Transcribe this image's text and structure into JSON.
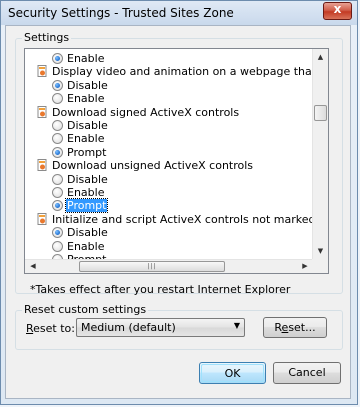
{
  "window": {
    "title": "Security Settings - Trusted Sites Zone",
    "close_glyph": "x"
  },
  "settings_group": {
    "label": "Settings"
  },
  "list": {
    "rows": [
      {
        "kind": "option",
        "label": "Enable",
        "checked": true
      },
      {
        "kind": "heading",
        "label": "Display video and animation on a webpage that does not use"
      },
      {
        "kind": "option",
        "label": "Disable",
        "checked": true
      },
      {
        "kind": "option",
        "label": "Enable",
        "checked": false
      },
      {
        "kind": "heading",
        "label": "Download signed ActiveX controls"
      },
      {
        "kind": "option",
        "label": "Disable",
        "checked": false
      },
      {
        "kind": "option",
        "label": "Enable",
        "checked": false
      },
      {
        "kind": "option",
        "label": "Prompt",
        "checked": true
      },
      {
        "kind": "heading",
        "label": "Download unsigned ActiveX controls"
      },
      {
        "kind": "option",
        "label": "Disable",
        "checked": false
      },
      {
        "kind": "option",
        "label": "Enable",
        "checked": false
      },
      {
        "kind": "option",
        "label": "Prompt",
        "checked": true,
        "focused": true
      },
      {
        "kind": "heading",
        "label": "Initialize and script ActiveX controls not marked as safe for sc"
      },
      {
        "kind": "option",
        "label": "Disable",
        "checked": true
      },
      {
        "kind": "option",
        "label": "Enable",
        "checked": false
      },
      {
        "kind": "option",
        "label": "Prompt",
        "checked": false
      }
    ]
  },
  "note": "*Takes effect after you restart Internet Explorer",
  "reset_group": {
    "label": "Reset custom settings",
    "reset_to_label": "Reset to:",
    "dropdown_value": "Medium (default)",
    "reset_button": "Reset..."
  },
  "buttons": {
    "ok": "OK",
    "cancel": "Cancel"
  },
  "colors": {
    "selection": "#3399ff",
    "radio_dot": "#1f6fd0",
    "close_button": "#c33a24"
  }
}
